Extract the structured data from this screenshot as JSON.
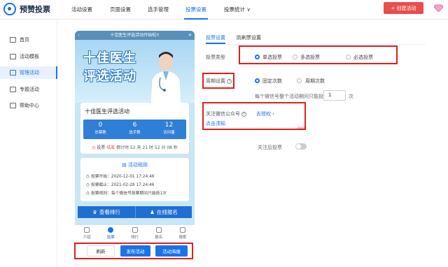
{
  "brand": {
    "logo_text": "预赞投票"
  },
  "topnav": {
    "items": [
      "活动设置",
      "页面设置",
      "选手管理",
      "投票设置",
      "投票统计 ∨"
    ],
    "active_index": 3,
    "create_button": "+ 创建活动",
    "accent_color": "#1a73e8",
    "create_color": "#e94d4d"
  },
  "sidebar": {
    "items": [
      {
        "label": "首页",
        "icon": "home-icon"
      },
      {
        "label": "活动模板",
        "icon": "template-icon"
      },
      {
        "label": "管理活动",
        "icon": "manage-icon"
      },
      {
        "label": "专题活动",
        "icon": "topic-icon"
      },
      {
        "label": "帮助中心",
        "icon": "help-icon"
      }
    ],
    "active_index": 2
  },
  "phone": {
    "header_title": "十佳医生评选活动开始啦!!",
    "banner_line1": "十佳医生",
    "banner_line2": "评选活动",
    "activity_title": "十佳医生评选活动",
    "stats": [
      {
        "value": "0",
        "label": "总票数"
      },
      {
        "value": "6",
        "label": "选手数"
      },
      {
        "value": "12",
        "label": "访问量"
      }
    ],
    "countdown_prefix": "投票",
    "countdown_status": "结束",
    "countdown_text": "倒计时 52 天 21 时 52 分 08 秒",
    "rules_title": "活动规则",
    "rules": [
      "投票开始：2020-12-01 17:24:46",
      "投票截止：2021-02-28 17:24:46",
      "投票规则：每个微信号投票期间只能投1次"
    ],
    "rank_button": "查看排行",
    "signup_button": "在线报名",
    "tabs": [
      "介绍",
      "投票",
      "排行",
      "报名",
      "搜索"
    ],
    "active_tab": 1
  },
  "actions": {
    "refresh": "刷新",
    "publish": "发布活动",
    "poster": "活动海报"
  },
  "settings": {
    "tabs": [
      "投票设置",
      "防刷票设置"
    ],
    "active_tab": 0,
    "vote_type_label": "投票类型",
    "vote_types": [
      "单选投票",
      "多选投票",
      "必选投票"
    ],
    "vote_type_selected": 0,
    "cycle_label": "周期设置",
    "cycles": [
      "固定次数",
      "周期次数"
    ],
    "cycle_selected": 0,
    "per_user_text": "每个微信号整个活动期间只能投",
    "per_user_value": "1",
    "per_user_unit": "次",
    "follow_label": "关注微信公众号",
    "follow_link": "去授权",
    "follow_hint": "点击须知",
    "follow_vote_label": "关注后投票",
    "follow_vote_enabled": false
  }
}
